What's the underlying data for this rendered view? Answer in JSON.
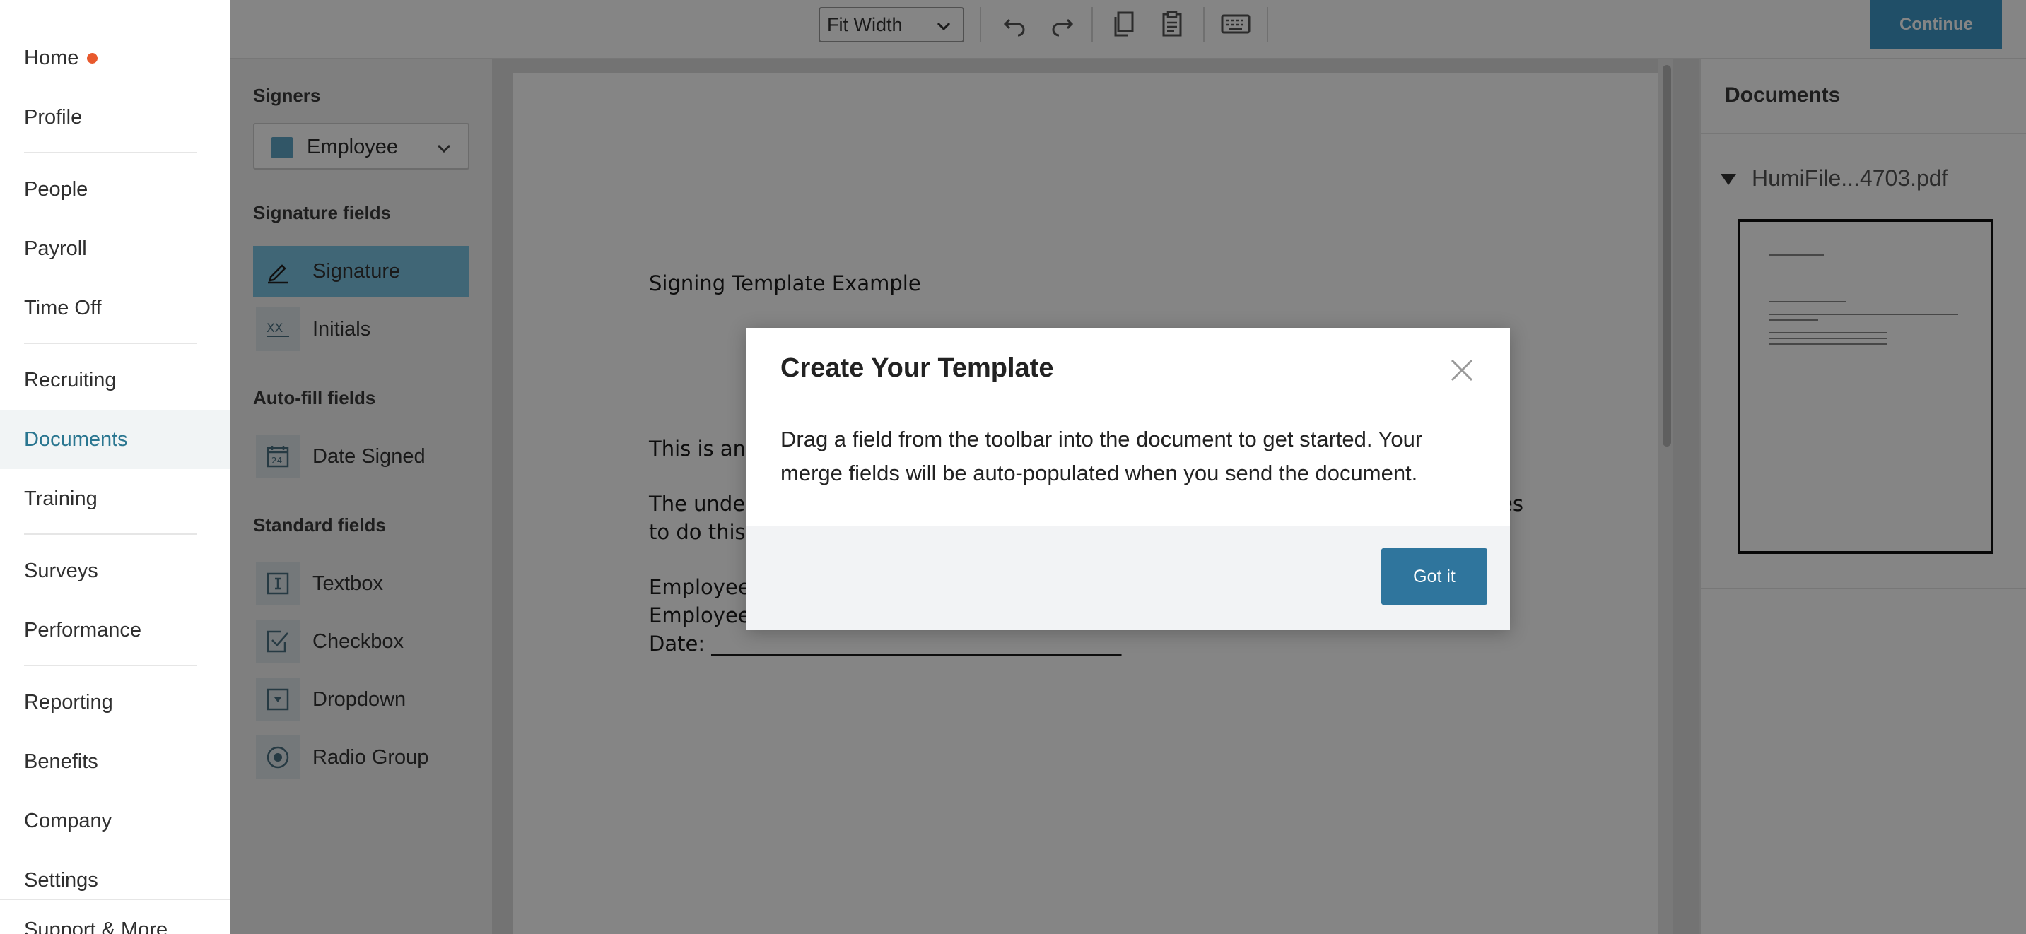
{
  "nav": {
    "items": [
      {
        "label": "Home"
      },
      {
        "label": "Profile"
      },
      {
        "label": "People"
      },
      {
        "label": "Payroll"
      },
      {
        "label": "Time Off"
      },
      {
        "label": "Recruiting"
      },
      {
        "label": "Documents"
      },
      {
        "label": "Training"
      },
      {
        "label": "Surveys"
      },
      {
        "label": "Performance"
      },
      {
        "label": "Reporting"
      },
      {
        "label": "Benefits"
      },
      {
        "label": "Company"
      },
      {
        "label": "Settings"
      }
    ],
    "active": "Documents",
    "support_label": "Support & More"
  },
  "toolbar": {
    "zoom_value": "Fit Width",
    "continue_label": "Continue",
    "icons": [
      "undo-icon",
      "redo-icon",
      "copy-icon",
      "paste-icon",
      "keyboard-icon"
    ]
  },
  "fields_panel": {
    "signers_heading": "Signers",
    "signer_selected": "Employee",
    "signer_color": "#5fa6c6",
    "signature_heading": "Signature fields",
    "signature_fields": [
      {
        "label": "Signature",
        "icon": "pen-icon"
      },
      {
        "label": "Initials",
        "icon": "initials-icon"
      }
    ],
    "autofill_heading": "Auto-fill fields",
    "autofill_fields": [
      {
        "label": "Date Signed",
        "icon": "calendar-icon"
      }
    ],
    "standard_heading": "Standard fields",
    "standard_fields": [
      {
        "label": "Textbox",
        "icon": "textbox-icon"
      },
      {
        "label": "Checkbox",
        "icon": "checkbox-icon"
      },
      {
        "label": "Dropdown",
        "icon": "dropdown-icon"
      },
      {
        "label": "Radio Group",
        "icon": "radio-icon"
      }
    ]
  },
  "document": {
    "title_line": "Signing Template Example",
    "line_1": "This is an e",
    "line_2a": "The under",
    "line_2b": "es",
    "line_3": "to do this a",
    "line_4": "Employee",
    "line_5": "Employee",
    "line_6": "Date: ________________________________________"
  },
  "docs_panel": {
    "heading": "Documents",
    "file_name": "HumiFile...4703.pdf"
  },
  "modal": {
    "title": "Create Your Template",
    "body": "Drag a field from the toolbar into the document to get started. Your merge fields will be auto-populated when you send the document.",
    "confirm_label": "Got it"
  }
}
